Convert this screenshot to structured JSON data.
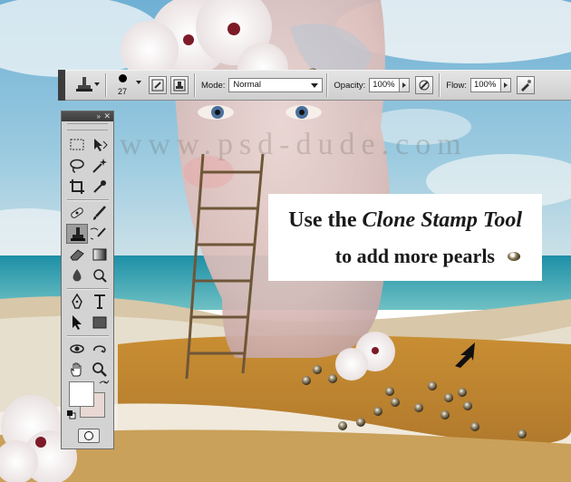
{
  "options_bar": {
    "tool_icon": "clone-stamp-icon",
    "brush_size": "27",
    "mode_label": "Mode:",
    "mode_value": "Normal",
    "opacity_label": "Opacity:",
    "opacity_value": "100%",
    "flow_label": "Flow:",
    "flow_value": "100%"
  },
  "tools_panel": {
    "collapse_label": "»",
    "close_label": "✕",
    "foreground_color": "#ffffff",
    "background_color": "#e8d7d2",
    "active_tool": "clone-stamp-icon"
  },
  "callout": {
    "line1_prefix": "Use the ",
    "line1_italic": "Clone Stamp Tool",
    "line2": "to add more pearls"
  },
  "watermark": "www.psd-dude.com"
}
